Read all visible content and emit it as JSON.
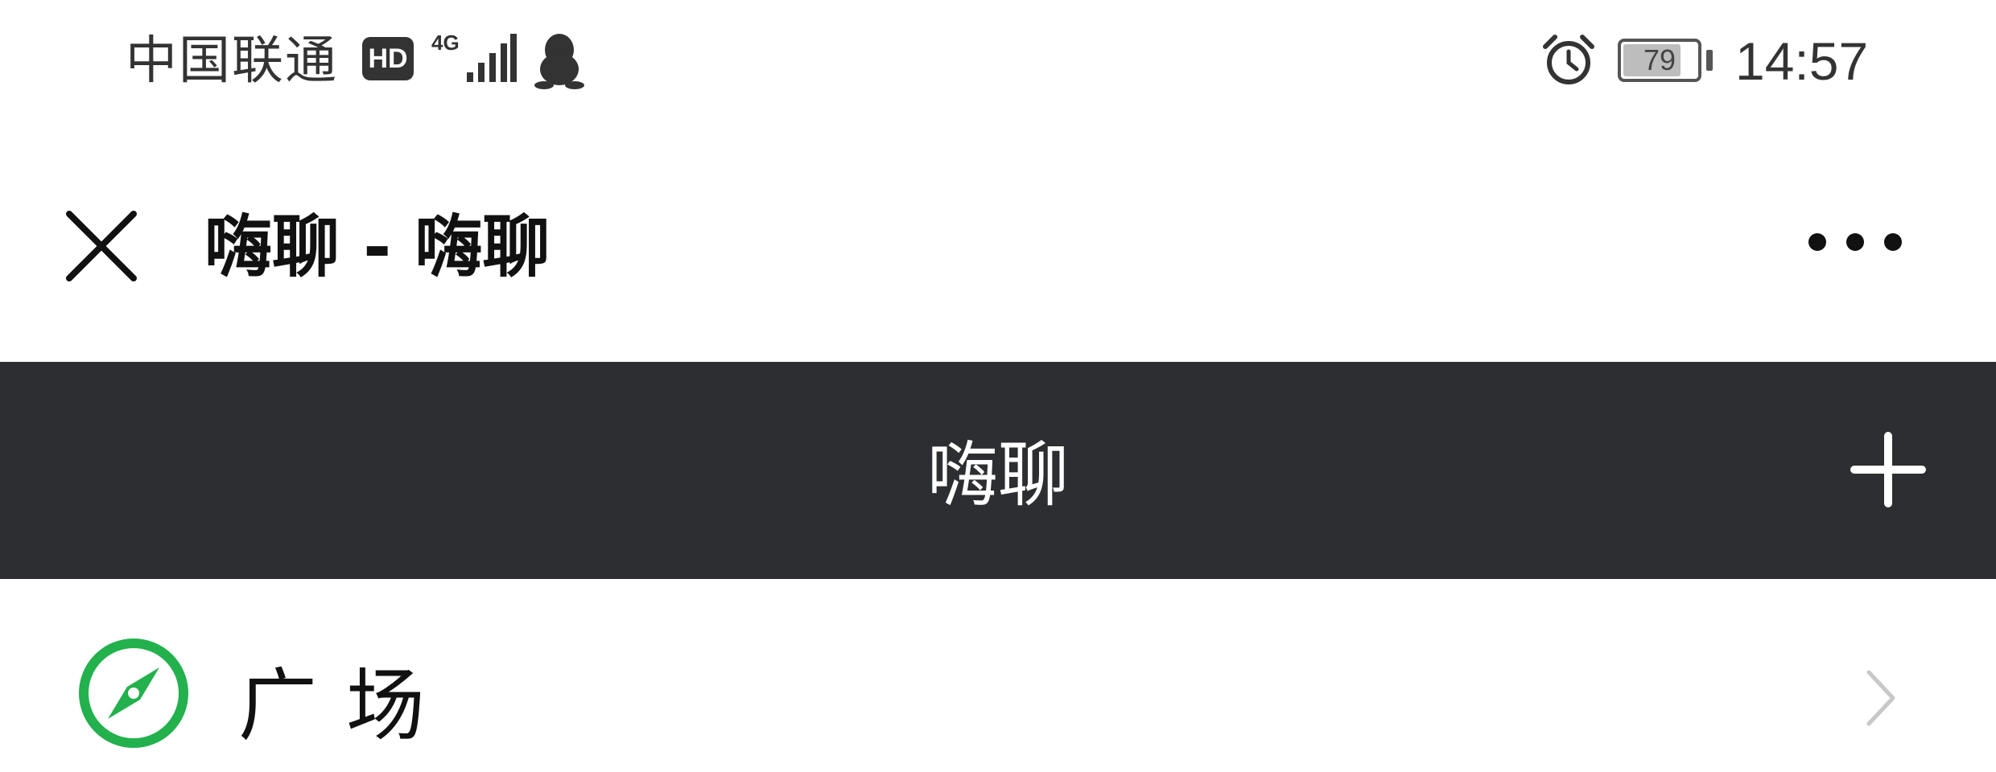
{
  "status_bar": {
    "carrier": "中国联通",
    "hd_badge": "HD",
    "network": "4G",
    "battery_level": "79",
    "battery_fraction": 0.79,
    "time": "14:57",
    "icons": [
      "signal-icon",
      "qq-icon",
      "alarm-icon",
      "battery-icon"
    ]
  },
  "nav_bar": {
    "title": "嗨聊 - 嗨聊",
    "close_icon": "close-icon",
    "more_icon": "more-icon"
  },
  "app_header": {
    "title": "嗨聊",
    "add_icon": "plus-icon",
    "background_color": "#2d2e31"
  },
  "list": {
    "items": [
      {
        "label": "广场",
        "icon": "compass-icon",
        "icon_color": "#22b14c"
      }
    ]
  }
}
